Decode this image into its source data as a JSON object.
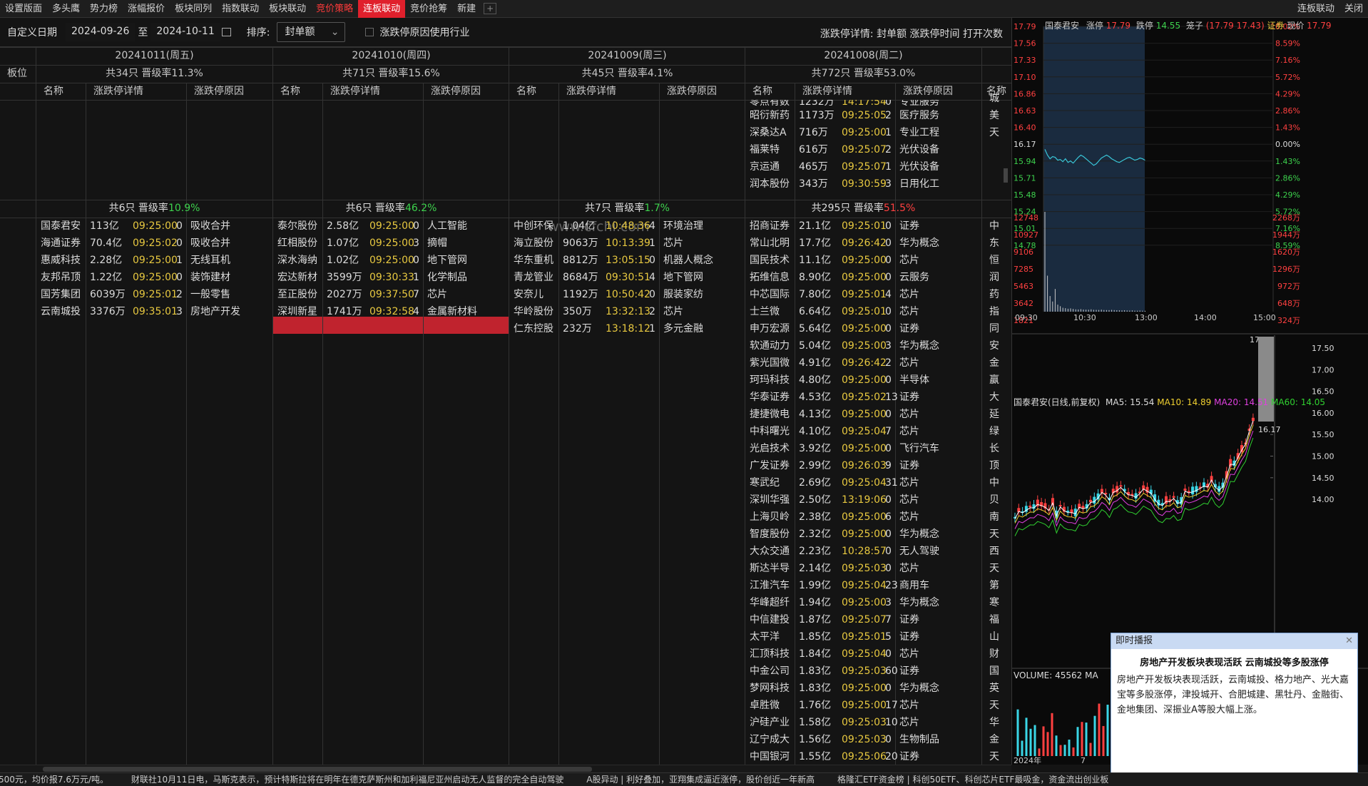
{
  "tabs": [
    "设置版面",
    "多头鹰",
    "势力榜",
    "涨幅报价",
    "板块同列",
    "指数联动",
    "板块联动",
    "竞价策略",
    "连板联动",
    "竞价抢筹",
    "新建"
  ],
  "tab_plus": "+",
  "tabs_right": [
    "连板联动",
    "关闭"
  ],
  "filter": {
    "label": "自定义日期",
    "date_from": "2024-09-26",
    "to": "至",
    "date_to": "2024-10-11",
    "sort_label": "排序:",
    "sort_value": "封单额",
    "checkbox_label": "涨跌停原因使用行业",
    "right_label": "涨跌停详情:",
    "right_items": "封单额 涨跌停时间 打开次数"
  },
  "row_label": "板位",
  "days": [
    {
      "date": "20241011(周五)",
      "summary": "共34只 晋级率11.3%",
      "cols": [
        "名称",
        "涨跌停详情",
        "涨跌停原因"
      ],
      "group2": {
        "count": "共6只 晋级率",
        "rate": "10.9%"
      },
      "rows": [
        [
          "国泰君安",
          "113亿",
          "09:25:00",
          "0",
          "吸收合并"
        ],
        [
          "海通证券",
          "70.4亿",
          "09:25:02",
          "0",
          "吸收合并"
        ],
        [
          "惠威科技",
          "2.28亿",
          "09:25:00",
          "1",
          "无线耳机"
        ],
        [
          "友邦吊顶",
          "1.22亿",
          "09:25:00",
          "0",
          "装饰建材"
        ],
        [
          "国芳集团",
          "6039万",
          "09:25:01",
          "2",
          "一般零售"
        ],
        [
          "云南城投",
          "3376万",
          "09:35:01",
          "3",
          "房地产开发"
        ]
      ]
    },
    {
      "date": "20241010(周四)",
      "summary": "共71只 晋级率15.6%",
      "cols": [
        "名称",
        "涨跌停详情",
        "涨跌停原因"
      ],
      "group2": {
        "count": "共6只 晋级率",
        "rate": "46.2%"
      },
      "rows": [
        [
          "泰尔股份",
          "2.58亿",
          "09:25:00",
          "0",
          "人工智能"
        ],
        [
          "红相股份",
          "1.07亿",
          "09:25:00",
          "3",
          "摘帽"
        ],
        [
          "深水海纳",
          "1.02亿",
          "09:25:00",
          "0",
          "地下管网"
        ],
        [
          "宏达新材",
          "3599万",
          "09:30:33",
          "1",
          "化学制品"
        ],
        [
          "至正股份",
          "2027万",
          "09:37:50",
          "7",
          "芯片"
        ],
        [
          "深圳新星",
          "1741万",
          "09:32:58",
          "4",
          "金属新材料"
        ]
      ]
    },
    {
      "date": "20241009(周三)",
      "summary": "共45只 晋级率4.1%",
      "cols": [
        "名称",
        "涨跌停详情",
        "涨跌停原因"
      ],
      "group2": {
        "count": "共7只 晋级率",
        "rate": "1.7%"
      },
      "rows": [
        [
          "中创环保",
          "1.04亿",
          "10:48:36",
          "4",
          "环境治理"
        ],
        [
          "海立股份",
          "9063万",
          "10:13:39",
          "1",
          "芯片"
        ],
        [
          "华东重机",
          "8812万",
          "13:05:15",
          "0",
          "机器人概念"
        ],
        [
          "青龙管业",
          "8684万",
          "09:30:51",
          "4",
          "地下管网"
        ],
        [
          "安奈儿",
          "1192万",
          "10:50:42",
          "0",
          "服装家纺"
        ],
        [
          "华岭股份",
          "350万",
          "13:32:13",
          "2",
          "芯片"
        ],
        [
          "仁东控股",
          "232万",
          "13:18:12",
          "1",
          "多元金融"
        ]
      ]
    },
    {
      "date": "20241008(周二)",
      "summary": "共772只 晋级率53.0%",
      "cols": [
        "名称",
        "涨跌停详情",
        "涨跌停原因",
        "名称"
      ],
      "top_rows": [
        [
          "零点有数",
          "1232万",
          "14:17:54",
          "0",
          "专业服务",
          "城"
        ],
        [
          "昭衍新药",
          "1173万",
          "09:25:05",
          "2",
          "医疗服务",
          "美"
        ],
        [
          "深桑达A",
          "716万",
          "09:25:00",
          "1",
          "专业工程",
          "天"
        ],
        [
          "福莱特",
          "616万",
          "09:25:07",
          "2",
          "光伏设备",
          ""
        ],
        [
          "京运通",
          "465万",
          "09:25:07",
          "1",
          "光伏设备",
          ""
        ],
        [
          "润本股份",
          "343万",
          "09:30:59",
          "3",
          "日用化工",
          ""
        ]
      ],
      "group2": {
        "count": "共295只 晋级率",
        "rate": "51.5%"
      },
      "rows": [
        [
          "招商证券",
          "21.1亿",
          "09:25:01",
          "0",
          "证券",
          "中"
        ],
        [
          "常山北明",
          "17.7亿",
          "09:26:42",
          "0",
          "华为概念",
          "东"
        ],
        [
          "国民技术",
          "11.1亿",
          "09:25:00",
          "0",
          "芯片",
          "恒"
        ],
        [
          "拓维信息",
          "8.90亿",
          "09:25:00",
          "0",
          "云服务",
          "润"
        ],
        [
          "中芯国际",
          "7.80亿",
          "09:25:01",
          "4",
          "芯片",
          "药"
        ],
        [
          "士兰微",
          "6.64亿",
          "09:25:01",
          "0",
          "芯片",
          "指"
        ],
        [
          "申万宏源",
          "5.64亿",
          "09:25:00",
          "0",
          "证券",
          "同"
        ],
        [
          "软通动力",
          "5.04亿",
          "09:25:00",
          "3",
          "华为概念",
          "安"
        ],
        [
          "紫光国微",
          "4.91亿",
          "09:26:42",
          "2",
          "芯片",
          "金"
        ],
        [
          "珂玛科技",
          "4.80亿",
          "09:25:00",
          "0",
          "半导体",
          "赢"
        ],
        [
          "华泰证券",
          "4.53亿",
          "09:25:02",
          "13",
          "证券",
          "大"
        ],
        [
          "捷捷微电",
          "4.13亿",
          "09:25:00",
          "0",
          "芯片",
          "延"
        ],
        [
          "中科曙光",
          "4.10亿",
          "09:25:04",
          "7",
          "芯片",
          "绿"
        ],
        [
          "光启技术",
          "3.92亿",
          "09:25:00",
          "0",
          "飞行汽车",
          "长"
        ],
        [
          "广发证券",
          "2.99亿",
          "09:26:03",
          "9",
          "证券",
          "顶"
        ],
        [
          "寒武纪",
          "2.69亿",
          "09:25:04",
          "31",
          "芯片",
          "中"
        ],
        [
          "深圳华强",
          "2.50亿",
          "13:19:06",
          "0",
          "芯片",
          "贝"
        ],
        [
          "上海贝岭",
          "2.38亿",
          "09:25:00",
          "6",
          "芯片",
          "南"
        ],
        [
          "智度股份",
          "2.32亿",
          "09:25:00",
          "0",
          "华为概念",
          "天"
        ],
        [
          "大众交通",
          "2.23亿",
          "10:28:57",
          "0",
          "无人驾驶",
          "西"
        ],
        [
          "斯达半导",
          "2.14亿",
          "09:25:03",
          "0",
          "芯片",
          "天"
        ],
        [
          "江淮汽车",
          "1.99亿",
          "09:25:04",
          "23",
          "商用车",
          "第"
        ],
        [
          "华峰超纤",
          "1.94亿",
          "09:25:00",
          "3",
          "华为概念",
          "寒"
        ],
        [
          "中信建投",
          "1.87亿",
          "09:25:07",
          "7",
          "证券",
          "福"
        ],
        [
          "太平洋",
          "1.85亿",
          "09:25:01",
          "5",
          "证券",
          "山"
        ],
        [
          "汇顶科技",
          "1.84亿",
          "09:25:04",
          "0",
          "芯片",
          "财"
        ],
        [
          "中金公司",
          "1.83亿",
          "09:25:03",
          "60",
          "证券",
          "国"
        ],
        [
          "梦网科技",
          "1.83亿",
          "09:25:00",
          "0",
          "华为概念",
          "英"
        ],
        [
          "卓胜微",
          "1.76亿",
          "09:25:00",
          "17",
          "芯片",
          "天"
        ],
        [
          "沪硅产业",
          "1.58亿",
          "09:25:03",
          "10",
          "芯片",
          "华"
        ],
        [
          "辽宁成大",
          "1.56亿",
          "09:25:03",
          "0",
          "生物制品",
          "金"
        ],
        [
          "中国银河",
          "1.55亿",
          "09:25:06",
          "20",
          "证券",
          "天"
        ]
      ]
    }
  ],
  "watermark": "www.cfchi.com",
  "quote": {
    "name": "国泰君安",
    "limit_up_label": "涨停",
    "limit_up": "17.79",
    "limit_down_label": "跌停",
    "limit_down": "14.55",
    "cage_label": "笼子",
    "cage": "(17.79 17.43)",
    "sector": "证券",
    "price_label": "现价",
    "price": "17.79"
  },
  "intraday": {
    "y_left": [
      "17.79",
      "17.56",
      "17.33",
      "17.10",
      "16.86",
      "16.63",
      "16.40",
      "16.17",
      "15.94",
      "15.71",
      "15.48",
      "15.24",
      "15.01",
      "14.78"
    ],
    "y_right": [
      "10.02%",
      "8.59%",
      "7.16%",
      "5.72%",
      "4.29%",
      "2.86%",
      "1.43%",
      "0.00%",
      "1.43%",
      "2.86%",
      "4.29%",
      "5.72%",
      "7.16%",
      "8.59%"
    ],
    "vol_left": [
      "12748",
      "10927",
      "9106",
      "7285",
      "5463",
      "3642",
      "1821"
    ],
    "vol_right": [
      "2268万",
      "1944万",
      "1620万",
      "1296万",
      "972万",
      "648万",
      "324万"
    ],
    "x": [
      "09:30",
      "10:30",
      "13:00",
      "14:00",
      "15:00"
    ],
    "price_series": [
      16.1,
      16.02,
      15.97,
      16.0,
      15.99,
      15.95,
      15.96,
      15.93,
      15.97,
      15.92,
      15.94,
      15.91,
      15.95,
      15.99,
      16.02,
      16.0,
      15.97,
      15.94,
      15.91,
      15.88,
      15.9,
      15.94,
      15.98,
      16.0,
      16.02,
      16.0,
      15.97,
      15.95,
      15.93,
      15.92,
      15.94,
      15.96,
      15.98,
      15.99,
      15.97,
      15.95,
      15.96,
      15.98,
      15.97,
      15.95
    ],
    "volume_series": [
      12748,
      4600,
      2000,
      1300,
      2900,
      900,
      700,
      500,
      450,
      380,
      420,
      350,
      300,
      280,
      330,
      270,
      260,
      250,
      300,
      240,
      230,
      220,
      260,
      210,
      200,
      190,
      230,
      200,
      180,
      170,
      160,
      180,
      150,
      140,
      160,
      130,
      120,
      140,
      120,
      110
    ]
  },
  "daily": {
    "title": "国泰君安(日线,前复权)",
    "ma5_label": "MA5: 15.54",
    "ma10_label": "MA10: 14.89",
    "ma20_label": "MA20: 14.51",
    "ma60_label": "MA60: 14.05",
    "y": [
      "17.50",
      "17.00",
      "16.50",
      "16.00",
      "15.50",
      "15.00",
      "14.50",
      "14.00"
    ],
    "hi_label": "17.79",
    "lo_label": "16.17",
    "volume_label": "VOLUME: 45562",
    "volume_label_cut": "MA",
    "x_labels": [
      "2024年",
      "7"
    ],
    "ma5_color": "#ffffff",
    "ma10_color": "#f0d030",
    "ma20_color": "#e040e0",
    "ma60_color": "#30d030"
  },
  "popup": {
    "header": "即时播报",
    "title": "房地产开发板块表现活跃 云南城投等多股涨停",
    "body": "房地产开发板块表现活跃，云南城投、格力地产、光大嘉宝等多股涨停，津投城开、合肥城建、黑牡丹、金融街、金地集团、深振业A等股大幅上涨。"
  },
  "ticker": [
    "500元，均价报7.6万元/吨。",
    "财联社10月11日电，马斯克表示，预计特斯拉将在明年在德克萨斯州和加利福尼亚州启动无人监督的完全自动驾驶",
    "A股异动 | 利好叠加，亚翔集成逼近涨停，股价创近一年新高",
    "格隆汇ETF资金榜 | 科创50ETF、科创芯片ETF最吸金，资金流出创业板"
  ],
  "colors": {
    "up": "#ff4040",
    "down": "#3dd24d",
    "accent": "#e0202c",
    "time": "#e8c940"
  }
}
